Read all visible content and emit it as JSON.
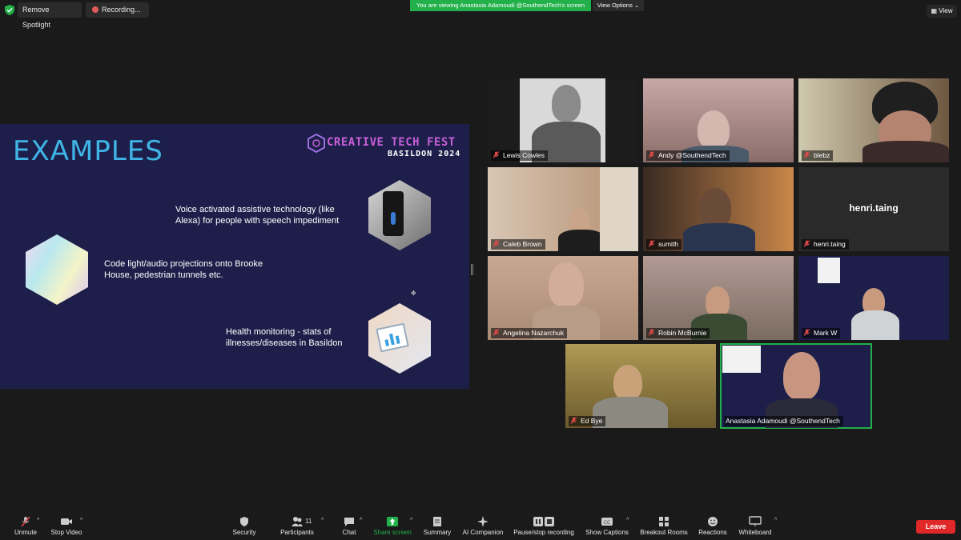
{
  "topbar": {
    "remove_spotlight": "Remove Spotlight",
    "recording": "Recording...",
    "viewing_banner": "You are viewing Anastasia Adamoudi @SouthendTech's screen",
    "view_options": "View Options",
    "view": "View"
  },
  "slide": {
    "title": "EXAMPLES",
    "logo_name": "CREATIVE TECH FEST",
    "logo_sub": "BASILDON 2024",
    "items": [
      {
        "text": "Voice activated assistive technology (like Alexa) for people with speech impediment"
      },
      {
        "text": "Code light/audio projections onto Brooke House, pedestrian tunnels etc."
      },
      {
        "text": "Health monitoring - stats of illnesses/diseases in Basildon"
      }
    ]
  },
  "participants": [
    {
      "name": "Lewis Cowles",
      "muted": true
    },
    {
      "name": "Andy @SouthendTech",
      "muted": true
    },
    {
      "name": "blebz",
      "muted": true
    },
    {
      "name": "Caleb Brown",
      "muted": true
    },
    {
      "name": "sumith",
      "muted": true
    },
    {
      "name": "henri.taing",
      "muted": true,
      "display_name": "henri.taing"
    },
    {
      "name": "Angelina Nazarchuk",
      "muted": true
    },
    {
      "name": "Robin McBurnie",
      "muted": true
    },
    {
      "name": "Mark W",
      "muted": true
    },
    {
      "name": "Ed Bye",
      "muted": true
    },
    {
      "name": "Anastasia Adamoudi @SouthendTech",
      "muted": false,
      "active_speaker": true
    }
  ],
  "toolbar": {
    "unmute": "Unmute",
    "stop_video": "Stop Video",
    "security": "Security",
    "participants": "Participants",
    "participants_count": "11",
    "chat": "Chat",
    "share_screen": "Share screen",
    "summary": "Summary",
    "ai_companion": "AI Companion",
    "pause_recording": "Pause/stop recording",
    "show_captions": "Show Captions",
    "breakout_rooms": "Breakout Rooms",
    "reactions": "Reactions",
    "whiteboard": "Whiteboard",
    "leave": "Leave"
  },
  "colors": {
    "background": "#1a1a1a",
    "share_green": "#22b04a",
    "leave_red": "#e02828",
    "slide_bg": "#1d1f4a",
    "slide_title": "#3fb5e6",
    "muted_red": "#e04a4a"
  }
}
